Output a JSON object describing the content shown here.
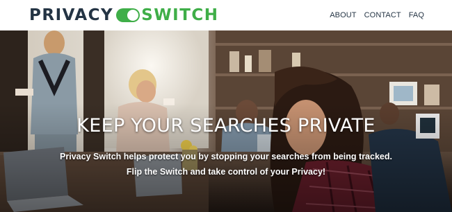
{
  "brand": {
    "name_part1": "PRIVACY",
    "name_part2": "SWITCH",
    "colors": {
      "navy": "#243444",
      "green": "#3fae48"
    }
  },
  "nav": {
    "items": [
      {
        "label": "ABOUT"
      },
      {
        "label": "CONTACT"
      },
      {
        "label": "FAQ"
      }
    ]
  },
  "hero": {
    "image": "cafe-scene-photo",
    "title": "KEEP YOUR SEARCHES PRIVATE",
    "subtitle_line1": "Privacy Switch helps protect you by stopping your searches from being tracked.",
    "subtitle_line2": "Flip the Switch and take control of your Privacy!"
  }
}
